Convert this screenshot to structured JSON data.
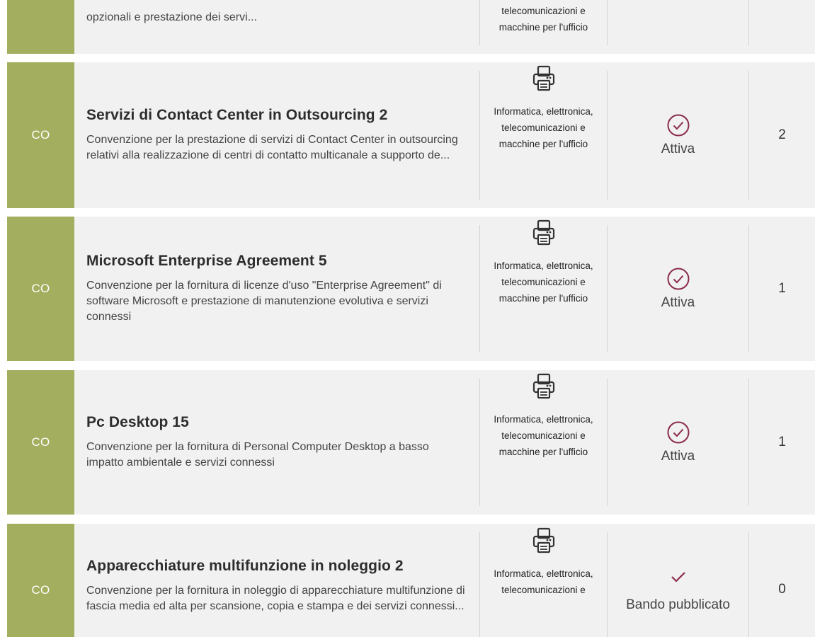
{
  "colors": {
    "type_badge_bg": "#a3ae5e",
    "status_accent": "#8b2c4a",
    "row_bg": "#f1f1f1"
  },
  "rows": [
    {
      "type": "",
      "title": "",
      "description": "opzionali e prestazione dei servi...",
      "category": "telecomunicazioni e macchine per l'ufficio",
      "category_icon": "printer-icon",
      "status": "",
      "status_icon": "",
      "count": ""
    },
    {
      "type": "CO",
      "title": "Servizi di Contact Center in Outsourcing 2",
      "description": "Convenzione per la prestazione di servizi di Contact Center in outsourcing relativi alla realizzazione di centri di contatto multicanale a supporto de...",
      "category": "Informatica, elettronica, telecomunicazioni e macchine per l'ufficio",
      "category_icon": "printer-icon",
      "status": "Attiva",
      "status_icon": "check-circle-icon",
      "count": "2"
    },
    {
      "type": "CO",
      "title": "Microsoft Enterprise Agreement 5",
      "description": "Convenzione per la fornitura di licenze d'uso \"Enterprise Agreement\" di software Microsoft e prestazione di manutenzione evolutiva e servizi connessi",
      "category": "Informatica, elettronica, telecomunicazioni e macchine per l'ufficio",
      "category_icon": "printer-icon",
      "status": "Attiva",
      "status_icon": "check-circle-icon",
      "count": "1"
    },
    {
      "type": "CO",
      "title": "Pc Desktop 15",
      "description": "Convenzione per la fornitura di Personal Computer Desktop a basso impatto ambientale e servizi connessi",
      "category": "Informatica, elettronica, telecomunicazioni e macchine per l'ufficio",
      "category_icon": "printer-icon",
      "status": "Attiva",
      "status_icon": "check-circle-icon",
      "count": "1"
    },
    {
      "type": "CO",
      "title": "Apparecchiature multifunzione in noleggio 2",
      "description": "Convenzione per la fornitura in noleggio di apparecchiature multifunzione di fascia media ed alta per scansione, copia e stampa e dei servizi connessi...",
      "category": "Informatica, elettronica, telecomunicazioni e",
      "category_icon": "printer-icon",
      "status": "Bando pubblicato",
      "status_icon": "check-icon",
      "count": "0"
    }
  ]
}
